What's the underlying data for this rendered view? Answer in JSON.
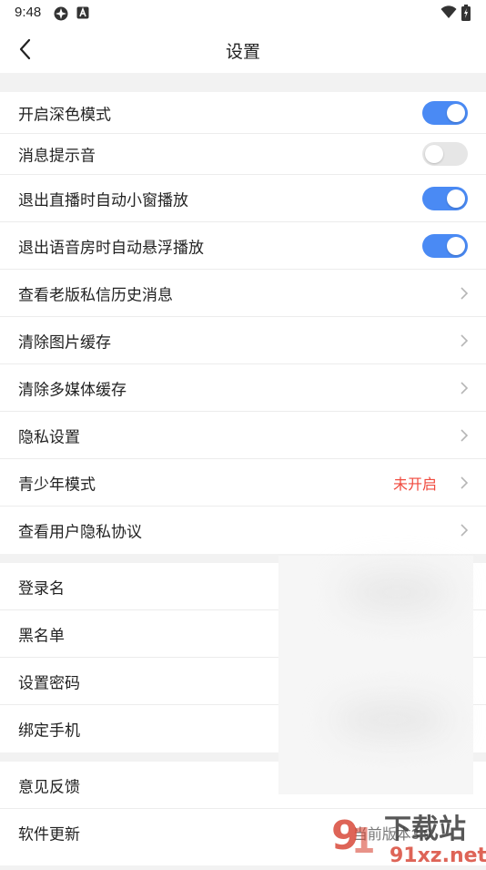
{
  "status_bar": {
    "time": "9:48"
  },
  "header": {
    "title": "设置"
  },
  "groups": {
    "main": [
      {
        "label": "开启深色模式",
        "toggle": "on"
      },
      {
        "label": "消息提示音",
        "toggle": "off"
      },
      {
        "label": "退出直播时自动小窗播放",
        "toggle": "on"
      },
      {
        "label": "退出语音房时自动悬浮播放",
        "toggle": "on"
      },
      {
        "label": "查看老版私信历史消息"
      },
      {
        "label": "清除图片缓存"
      },
      {
        "label": "清除多媒体缓存"
      },
      {
        "label": "隐私设置"
      },
      {
        "label": "青少年模式",
        "value": "未开启"
      },
      {
        "label": "查看用户隐私协议"
      }
    ],
    "account": [
      {
        "label": "登录名"
      },
      {
        "label": "黑名单"
      },
      {
        "label": "设置密码"
      },
      {
        "label": "绑定手机"
      }
    ],
    "other": [
      {
        "label": "意见反馈"
      },
      {
        "label": "软件更新",
        "value": "当前版本3.9"
      }
    ]
  },
  "watermark": {
    "line1": "下载站",
    "line2": "91xz.net"
  },
  "colors": {
    "accent": "#4a8af4",
    "warning": "#f04a3e",
    "toggle_off": "#e6e6e6"
  }
}
